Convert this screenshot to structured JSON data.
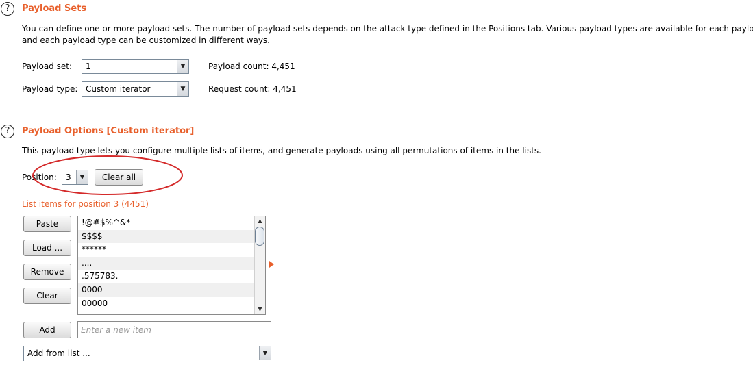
{
  "payload_sets": {
    "title": "Payload Sets",
    "description_line1": "You can define one or more payload sets. The number of payload sets depends on the attack type defined in the Positions tab. Various payload types are available for each payload set,",
    "description_line2": "and each payload type can be customized in different ways.",
    "payload_set_label": "Payload set:",
    "payload_set_value": "1",
    "payload_type_label": "Payload type:",
    "payload_type_value": "Custom iterator",
    "payload_count": "Payload count:  4,451",
    "request_count": "Request count:  4,451"
  },
  "payload_options": {
    "title": "Payload Options [Custom iterator]",
    "description": "This payload type lets you configure multiple lists of items, and generate payloads using all permutations of items in the lists.",
    "position_label": "Position:",
    "position_value": "3",
    "clear_all_label": "Clear all",
    "list_label": "List items for position 3 (4451)",
    "buttons": {
      "paste": "Paste",
      "load": "Load ...",
      "remove": "Remove",
      "clear": "Clear",
      "add": "Add"
    },
    "items": [
      "!@#$%^&*",
      "$$$$",
      "******",
      "....",
      ".575783.",
      "0000",
      "00000"
    ],
    "new_item_placeholder": "Enter a new item",
    "add_from_list_value": "Add from list ..."
  },
  "annotation_color": "#d42a2a",
  "accent_color": "#e8602c"
}
